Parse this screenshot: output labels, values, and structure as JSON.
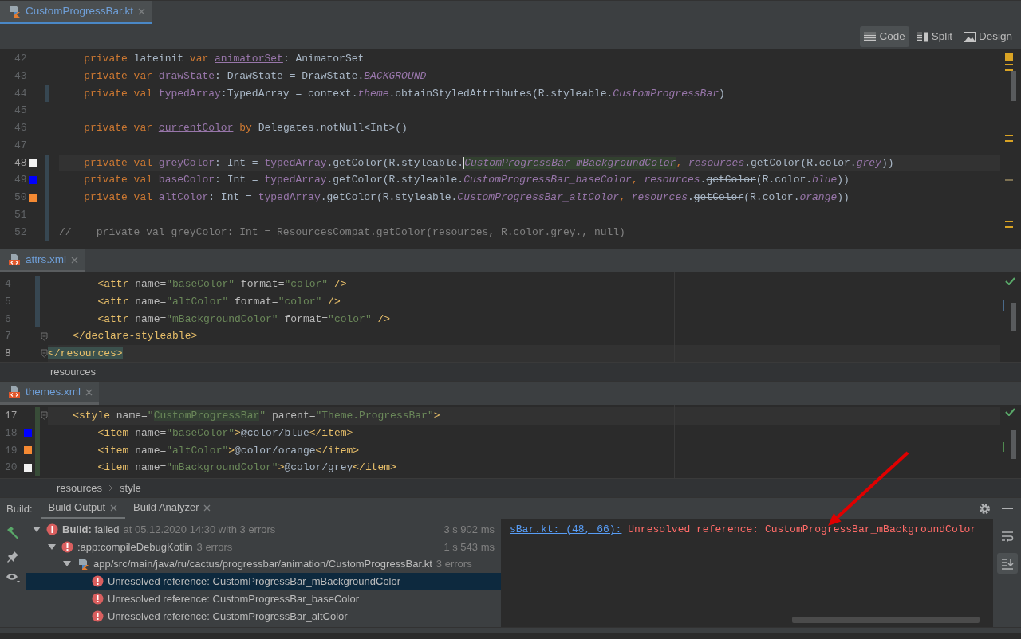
{
  "editors": [
    {
      "tab": {
        "label": "CustomProgressBar.kt",
        "kind": "kotlin",
        "selected": true
      },
      "view_modes": [
        {
          "label": "Code",
          "kind": "code",
          "selected": true
        },
        {
          "label": "Split",
          "kind": "split",
          "selected": false
        },
        {
          "label": "Design",
          "kind": "design",
          "selected": false
        }
      ],
      "lines": [
        {
          "number": "42",
          "tokens": [
            {
              "text": "    private ",
              "kind": "kw"
            },
            {
              "text": "lateinit ",
              "kind": "plain"
            },
            {
              "text": "var ",
              "kind": "kw"
            },
            {
              "text": "animatorSet",
              "kind": "field-mut"
            },
            {
              "text": ": AnimatorSet",
              "kind": "plain"
            }
          ]
        },
        {
          "number": "43",
          "tokens": [
            {
              "text": "    private var ",
              "kind": "kw"
            },
            {
              "text": "drawState",
              "kind": "field-mut"
            },
            {
              "text": ": DrawState = DrawState.",
              "kind": "plain"
            },
            {
              "text": "BACKGROUND",
              "kind": "static"
            }
          ]
        },
        {
          "number": "44",
          "modified": true,
          "tokens": [
            {
              "text": "    private val ",
              "kind": "kw"
            },
            {
              "text": "typedArray",
              "kind": "field"
            },
            {
              "text": ":TypedArray = context.",
              "kind": "plain"
            },
            {
              "text": "theme",
              "kind": "static"
            },
            {
              "text": ".obtainStyledAttributes(R.styleable.",
              "kind": "plain"
            },
            {
              "text": "CustomProgressBar",
              "kind": "static"
            },
            {
              "text": ")",
              "kind": "plain"
            }
          ]
        },
        {
          "number": "45"
        },
        {
          "number": "46",
          "tokens": [
            {
              "text": "    private var ",
              "kind": "kw"
            },
            {
              "text": "currentColor",
              "kind": "field-mut"
            },
            {
              "text": " by ",
              "kind": "kw"
            },
            {
              "text": "Delegates.notNull<Int>()",
              "kind": "plain"
            }
          ]
        },
        {
          "number": "47"
        },
        {
          "number": "48",
          "current": true,
          "modified": true,
          "color": "#f2f2f2",
          "tokens": [
            {
              "text": "    private val ",
              "kind": "kw"
            },
            {
              "text": "greyColor",
              "kind": "field"
            },
            {
              "text": ": Int = ",
              "kind": "plain"
            },
            {
              "text": "typedArray",
              "kind": "field"
            },
            {
              "text": ".getColor(R.styleable.",
              "kind": "plain"
            },
            {
              "text": "CustomProgressBar_mBackgroundColor",
              "kind": "error-ref"
            },
            {
              "text": ", ",
              "kind": "kw"
            },
            {
              "text": "resources",
              "kind": "static"
            },
            {
              "text": ".",
              "kind": "plain"
            },
            {
              "text": "getColor",
              "kind": "deprecated"
            },
            {
              "text": "(R.color.",
              "kind": "plain"
            },
            {
              "text": "grey",
              "kind": "static"
            },
            {
              "text": "))",
              "kind": "plain"
            }
          ]
        },
        {
          "number": "49",
          "modified": true,
          "color": "#0000ff",
          "tokens": [
            {
              "text": "    private val ",
              "kind": "kw"
            },
            {
              "text": "baseColor",
              "kind": "field"
            },
            {
              "text": ": Int = ",
              "kind": "plain"
            },
            {
              "text": "typedArray",
              "kind": "field"
            },
            {
              "text": ".getColor(R.styleable.",
              "kind": "plain"
            },
            {
              "text": "CustomProgressBar_baseColor",
              "kind": "static"
            },
            {
              "text": ", ",
              "kind": "kw"
            },
            {
              "text": "resources",
              "kind": "static"
            },
            {
              "text": ".",
              "kind": "plain"
            },
            {
              "text": "getColor",
              "kind": "deprecated"
            },
            {
              "text": "(R.color.",
              "kind": "plain"
            },
            {
              "text": "blue",
              "kind": "static"
            },
            {
              "text": "))",
              "kind": "plain"
            }
          ]
        },
        {
          "number": "50",
          "modified": true,
          "color": "#f58a33",
          "tokens": [
            {
              "text": "    private val ",
              "kind": "kw"
            },
            {
              "text": "altColor",
              "kind": "field"
            },
            {
              "text": ": Int = ",
              "kind": "plain"
            },
            {
              "text": "typedArray",
              "kind": "field"
            },
            {
              "text": ".getColor(R.styleable.",
              "kind": "plain"
            },
            {
              "text": "CustomProgressBar_altColor",
              "kind": "static"
            },
            {
              "text": ", ",
              "kind": "kw"
            },
            {
              "text": "resources",
              "kind": "static"
            },
            {
              "text": ".",
              "kind": "plain"
            },
            {
              "text": "getColor",
              "kind": "deprecated"
            },
            {
              "text": "(R.color.",
              "kind": "plain"
            },
            {
              "text": "orange",
              "kind": "static"
            },
            {
              "text": "))",
              "kind": "plain"
            }
          ]
        },
        {
          "number": "51",
          "modified": true
        },
        {
          "number": "52",
          "modified": true,
          "tokens": [
            {
              "text": "//    private val greyColor: Int = ResourcesCompat.getColor(resources, R.color.grey., null)",
              "kind": "comment"
            }
          ]
        }
      ]
    },
    {
      "tab": {
        "label": "attrs.xml",
        "kind": "xml",
        "selected": false
      },
      "lines": [
        {
          "number": "4",
          "modified": true,
          "tokens": [
            {
              "text": "        <attr",
              "kind": "tag"
            },
            {
              "text": " name=",
              "kind": "attr"
            },
            {
              "text": "\"baseColor\"",
              "kind": "str"
            },
            {
              "text": " format=",
              "kind": "attr"
            },
            {
              "text": "\"color\"",
              "kind": "str"
            },
            {
              "text": " />",
              "kind": "tag"
            }
          ]
        },
        {
          "number": "5",
          "modified": true,
          "tokens": [
            {
              "text": "        <attr",
              "kind": "tag"
            },
            {
              "text": " name=",
              "kind": "attr"
            },
            {
              "text": "\"altColor\"",
              "kind": "str"
            },
            {
              "text": " format=",
              "kind": "attr"
            },
            {
              "text": "\"color\"",
              "kind": "str"
            },
            {
              "text": " />",
              "kind": "tag"
            }
          ]
        },
        {
          "number": "6",
          "modified": true,
          "tokens": [
            {
              "text": "        <attr",
              "kind": "tag"
            },
            {
              "text": " name=",
              "kind": "attr"
            },
            {
              "text": "\"mBackgroundColor\"",
              "kind": "str"
            },
            {
              "text": " format=",
              "kind": "attr"
            },
            {
              "text": "\"color\"",
              "kind": "str"
            },
            {
              "text": " />",
              "kind": "tag"
            }
          ]
        },
        {
          "number": "7",
          "fold": true,
          "tokens": [
            {
              "text": "    </declare-styleable>",
              "kind": "tag"
            }
          ]
        },
        {
          "number": "8",
          "current": true,
          "fold": true,
          "tokens": [
            {
              "text": "</resources>",
              "kind": "tag-match"
            }
          ]
        }
      ],
      "breadcrumbs": [
        "resources"
      ]
    },
    {
      "tab": {
        "label": "themes.xml",
        "kind": "xml",
        "selected": false
      },
      "lines": [
        {
          "number": "17",
          "current": true,
          "added": true,
          "fold": true,
          "tokens": [
            {
              "text": "    <style",
              "kind": "tag"
            },
            {
              "text": " name=",
              "kind": "attr"
            },
            {
              "text": "\"",
              "kind": "str"
            },
            {
              "text": "CustomProgressBar",
              "kind": "str-match"
            },
            {
              "text": "\"",
              "kind": "str"
            },
            {
              "text": " parent=",
              "kind": "attr"
            },
            {
              "text": "\"Theme.ProgressBar\"",
              "kind": "str"
            },
            {
              "text": ">",
              "kind": "tag"
            }
          ]
        },
        {
          "number": "18",
          "added": true,
          "color": "#0000ff",
          "tokens": [
            {
              "text": "        <item",
              "kind": "tag"
            },
            {
              "text": " name=",
              "kind": "attr"
            },
            {
              "text": "\"baseColor\"",
              "kind": "str"
            },
            {
              "text": ">",
              "kind": "tag"
            },
            {
              "text": "@color/blue",
              "kind": "plain"
            },
            {
              "text": "</item>",
              "kind": "tag"
            }
          ]
        },
        {
          "number": "19",
          "added": true,
          "color": "#f58a33",
          "tokens": [
            {
              "text": "        <item",
              "kind": "tag"
            },
            {
              "text": " name=",
              "kind": "attr"
            },
            {
              "text": "\"altColor\"",
              "kind": "str"
            },
            {
              "text": ">",
              "kind": "tag"
            },
            {
              "text": "@color/orange",
              "kind": "plain"
            },
            {
              "text": "</item>",
              "kind": "tag"
            }
          ]
        },
        {
          "number": "20",
          "added": true,
          "color": "#f2f2f2",
          "tokens": [
            {
              "text": "        <item",
              "kind": "tag"
            },
            {
              "text": " name=",
              "kind": "attr"
            },
            {
              "text": "\"mBackgroundColor\"",
              "kind": "str"
            },
            {
              "text": ">",
              "kind": "tag"
            },
            {
              "text": "@color/grey",
              "kind": "plain"
            },
            {
              "text": "</item>",
              "kind": "tag"
            }
          ]
        }
      ],
      "breadcrumbs": [
        "resources",
        "style"
      ]
    }
  ],
  "build": {
    "label": "Build:",
    "tabs": [
      {
        "label": "Build Output",
        "selected": true
      },
      {
        "label": "Build Analyzer",
        "selected": false
      }
    ],
    "tree": [
      {
        "kind": "error",
        "label": "**Build:** failed",
        "detail": "at 05.12.2020 14:30 with 3 errors",
        "time": "3 s 902 ms",
        "expanded": true,
        "selected": false,
        "children": [
          {
            "kind": "error",
            "label": ":app:compileDebugKotlin",
            "detail": "3 errors",
            "time": "1 s 543 ms",
            "expanded": true,
            "selected": false,
            "children": [
              {
                "kind": "file",
                "label": "app/src/main/java/ru/cactus/progressbar/animation/CustomProgressBar.kt",
                "detail": "3 errors",
                "expanded": true,
                "selected": false,
                "children": [
                  {
                    "kind": "error",
                    "label": "Unresolved reference: CustomProgressBar_mBackgroundColor",
                    "selected": true
                  },
                  {
                    "kind": "error",
                    "label": "Unresolved reference: CustomProgressBar_baseColor",
                    "selected": false
                  },
                  {
                    "kind": "error",
                    "label": "Unresolved reference: CustomProgressBar_altColor",
                    "selected": false
                  }
                ]
              }
            ]
          }
        ]
      }
    ],
    "console": {
      "link": "sBar.kt: (48, 66):",
      "message": "Unresolved reference: CustomProgressBar_mBackgroundColor"
    },
    "console_tools": [
      {
        "kind": "wrap",
        "on": false
      },
      {
        "kind": "scroll-end",
        "on": true
      }
    ]
  }
}
